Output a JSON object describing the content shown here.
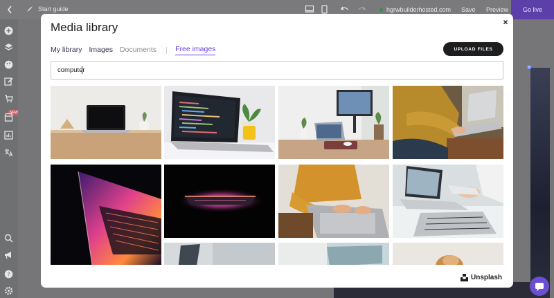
{
  "topbar": {
    "guide_label": "Start guide",
    "domain": "hgrwbuilderhosted.com",
    "save_label": "Save",
    "preview_label": "Preview",
    "go_live_label": "Go live"
  },
  "sidebar": {
    "badge": "NEW",
    "icons": [
      "plus-icon",
      "layers-icon",
      "palette-icon",
      "edit-icon",
      "cart-icon",
      "store-icon",
      "analytics-icon",
      "translate-icon",
      "search-icon",
      "megaphone-icon",
      "help-icon",
      "settings-icon"
    ]
  },
  "modal": {
    "title": "Media library",
    "tabs": [
      {
        "label": "My library",
        "state": "normal"
      },
      {
        "label": "Images",
        "state": "normal"
      },
      {
        "label": "Documents",
        "state": "disabled"
      },
      {
        "label": "Free images",
        "state": "active"
      }
    ],
    "upload_label": "UPLOAD FILES",
    "search": {
      "value": "computer",
      "placeholder": ""
    },
    "images": [
      {
        "name": "laptop-on-wooden-desk"
      },
      {
        "name": "laptop-with-code"
      },
      {
        "name": "desk-with-monitor-and-laptop"
      },
      {
        "name": "person-typing-on-laptop"
      },
      {
        "name": "colorful-laptop-keyboard"
      },
      {
        "name": "glowing-laptop-in-dark"
      },
      {
        "name": "hands-on-laptop-yellow-sweater"
      },
      {
        "name": "people-working-on-laptops"
      },
      {
        "name": "partial-image-9"
      },
      {
        "name": "partial-image-10"
      },
      {
        "name": "partial-image-11"
      },
      {
        "name": "partial-image-12"
      }
    ],
    "attribution": "Unsplash"
  },
  "colors": {
    "accent": "#673de6",
    "dark": "#1d1e20",
    "go_live": "#5c3fa8"
  }
}
